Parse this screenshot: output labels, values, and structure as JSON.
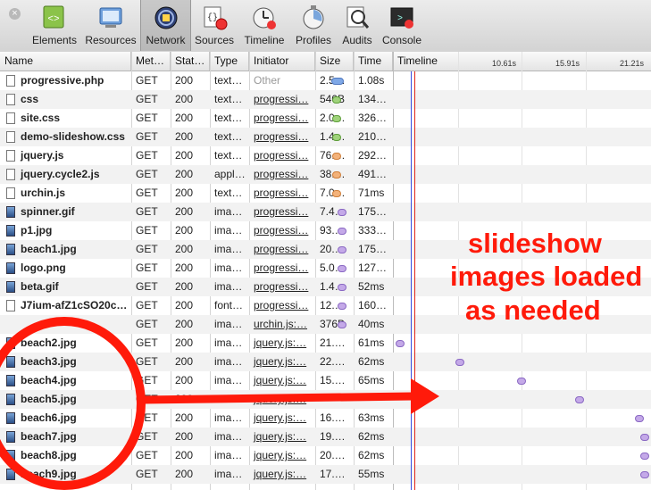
{
  "toolbar": {
    "tools": [
      {
        "label": "Elements",
        "icon": "elements-icon",
        "active": false
      },
      {
        "label": "Resources",
        "icon": "resources-icon",
        "active": false
      },
      {
        "label": "Network",
        "icon": "network-icon",
        "active": true
      },
      {
        "label": "Sources",
        "icon": "sources-icon",
        "active": false
      },
      {
        "label": "Timeline",
        "icon": "timeline-icon",
        "active": false
      },
      {
        "label": "Profiles",
        "icon": "profiles-icon",
        "active": false
      },
      {
        "label": "Audits",
        "icon": "audits-icon",
        "active": false
      },
      {
        "label": "Console",
        "icon": "console-icon",
        "active": false
      }
    ]
  },
  "columns": {
    "name": "Name",
    "method": "Met…",
    "status": "Stat…",
    "type": "Type",
    "initiator": "Initiator",
    "size": "Size",
    "time": "Time",
    "timeline": "Timeline"
  },
  "timeline_ticks": [
    "10.61s",
    "15.91s",
    "21.21s"
  ],
  "requests": [
    {
      "name": "progressive.php",
      "method": "GET",
      "status": "200",
      "type": "text…",
      "initiator": "Other",
      "size": "2.5…",
      "time": "1.08s",
      "icon": "doc",
      "bar": "blue",
      "start_s": 0.0,
      "end_s": 1.08
    },
    {
      "name": "css",
      "method": "GET",
      "status": "200",
      "type": "text…",
      "initiator": "progressi…",
      "size": "540B",
      "time": "134…",
      "icon": "doc",
      "bar": "green",
      "start_s": 0.1,
      "end_s": 0.3
    },
    {
      "name": "site.css",
      "method": "GET",
      "status": "200",
      "type": "text…",
      "initiator": "progressi…",
      "size": "2.0…",
      "time": "326…",
      "icon": "doc",
      "bar": "green",
      "start_s": 0.1,
      "end_s": 0.4
    },
    {
      "name": "demo-slideshow.css",
      "method": "GET",
      "status": "200",
      "type": "text…",
      "initiator": "progressi…",
      "size": "1.4…",
      "time": "210…",
      "icon": "doc",
      "bar": "green",
      "start_s": 0.1,
      "end_s": 0.35
    },
    {
      "name": "jquery.js",
      "method": "GET",
      "status": "200",
      "type": "text…",
      "initiator": "progressi…",
      "size": "76.…",
      "time": "292…",
      "icon": "doc",
      "bar": "orange",
      "start_s": 0.1,
      "end_s": 0.4
    },
    {
      "name": "jquery.cycle2.js",
      "method": "GET",
      "status": "200",
      "type": "appl…",
      "initiator": "progressi…",
      "size": "38.…",
      "time": "491…",
      "icon": "doc",
      "bar": "orange",
      "start_s": 0.1,
      "end_s": 0.6
    },
    {
      "name": "urchin.js",
      "method": "GET",
      "status": "200",
      "type": "text…",
      "initiator": "progressi…",
      "size": "7.0…",
      "time": "71ms",
      "icon": "doc",
      "bar": "orange",
      "start_s": 0.1,
      "end_s": 0.2
    },
    {
      "name": "spinner.gif",
      "method": "GET",
      "status": "200",
      "type": "ima…",
      "initiator": "progressi…",
      "size": "7.4…",
      "time": "175…",
      "icon": "gif",
      "bar": "purple",
      "start_s": 0.5,
      "end_s": 0.7
    },
    {
      "name": "p1.jpg",
      "method": "GET",
      "status": "200",
      "type": "ima…",
      "initiator": "progressi…",
      "size": "93.…",
      "time": "333…",
      "icon": "img",
      "bar": "purple",
      "start_s": 0.5,
      "end_s": 0.8
    },
    {
      "name": "beach1.jpg",
      "method": "GET",
      "status": "200",
      "type": "ima…",
      "initiator": "progressi…",
      "size": "20.…",
      "time": "175…",
      "icon": "img",
      "bar": "purple",
      "start_s": 0.5,
      "end_s": 0.7
    },
    {
      "name": "logo.png",
      "method": "GET",
      "status": "200",
      "type": "ima…",
      "initiator": "progressi…",
      "size": "5.0…",
      "time": "127…",
      "icon": "img",
      "bar": "purple",
      "start_s": 0.5,
      "end_s": 0.65
    },
    {
      "name": "beta.gif",
      "method": "GET",
      "status": "200",
      "type": "ima…",
      "initiator": "progressi…",
      "size": "1.4…",
      "time": "52ms",
      "icon": "gif",
      "bar": "purple",
      "start_s": 0.5,
      "end_s": 0.6
    },
    {
      "name": "J7ium-afZ1cSO20c…",
      "method": "GET",
      "status": "200",
      "type": "font…",
      "initiator": "progressi…",
      "size": "12.…",
      "time": "160…",
      "icon": "doc",
      "bar": "purple",
      "start_s": 0.5,
      "end_s": 0.7
    },
    {
      "name": "",
      "method": "GET",
      "status": "200",
      "type": "ima…",
      "initiator": "urchin.js:…",
      "size": "376B",
      "time": "40ms",
      "icon": "none",
      "bar": "purple",
      "start_s": 0.5,
      "end_s": 0.6
    },
    {
      "name": "beach2.jpg",
      "method": "GET",
      "status": "200",
      "type": "ima…",
      "initiator": "jquery.js:…",
      "size": "21.…",
      "time": "61ms",
      "icon": "img",
      "bar": "purple",
      "start_s": 5.4,
      "end_s": 5.5
    },
    {
      "name": "beach3.jpg",
      "method": "GET",
      "status": "200",
      "type": "ima…",
      "initiator": "jquery.js:…",
      "size": "22.…",
      "time": "62ms",
      "icon": "img",
      "bar": "purple",
      "start_s": 10.4,
      "end_s": 10.5
    },
    {
      "name": "beach4.jpg",
      "method": "GET",
      "status": "200",
      "type": "ima…",
      "initiator": "jquery.js:…",
      "size": "15.…",
      "time": "65ms",
      "icon": "img",
      "bar": "purple",
      "start_s": 15.5,
      "end_s": 15.6
    },
    {
      "name": "beach5.jpg",
      "method": "GET",
      "status": "200",
      "type": "ima…",
      "initiator": "jquery.js:…",
      "size": "",
      "time": "",
      "icon": "img",
      "bar": "purple",
      "start_s": 20.4,
      "end_s": 20.5
    },
    {
      "name": "beach6.jpg",
      "method": "GET",
      "status": "200",
      "type": "ima…",
      "initiator": "jquery.js:…",
      "size": "16.…",
      "time": "63ms",
      "icon": "img",
      "bar": "purple",
      "start_s": 25.4,
      "end_s": 25.5
    },
    {
      "name": "beach7.jpg",
      "method": "GET",
      "status": "200",
      "type": "ima…",
      "initiator": "jquery.js:…",
      "size": "19.…",
      "time": "62ms",
      "icon": "img",
      "bar": "purple",
      "start_s": 30.4,
      "end_s": 30.5
    },
    {
      "name": "beach8.jpg",
      "method": "GET",
      "status": "200",
      "type": "ima…",
      "initiator": "jquery.js:…",
      "size": "20.…",
      "time": "62ms",
      "icon": "img",
      "bar": "purple",
      "start_s": 35.4,
      "end_s": 35.5
    },
    {
      "name": "beach9.jpg",
      "method": "GET",
      "status": "200",
      "type": "ima…",
      "initiator": "jquery.js:…",
      "size": "17.…",
      "time": "55ms",
      "icon": "img",
      "bar": "purple",
      "start_s": 40.4,
      "end_s": 40.5
    }
  ],
  "bar_colors": {
    "blue": {
      "fill": "#7fa8e6",
      "stroke": "#4f78c0"
    },
    "green": {
      "fill": "#9fd27a",
      "stroke": "#5e9e3a"
    },
    "orange": {
      "fill": "#f3b27a",
      "stroke": "#cf7f3a"
    },
    "purple": {
      "fill": "#c4a9e8",
      "stroke": "#8a68c3"
    }
  },
  "annotation": {
    "lines": [
      "slideshow",
      "images loaded",
      "as needed"
    ],
    "color": "#ff1a0a"
  }
}
